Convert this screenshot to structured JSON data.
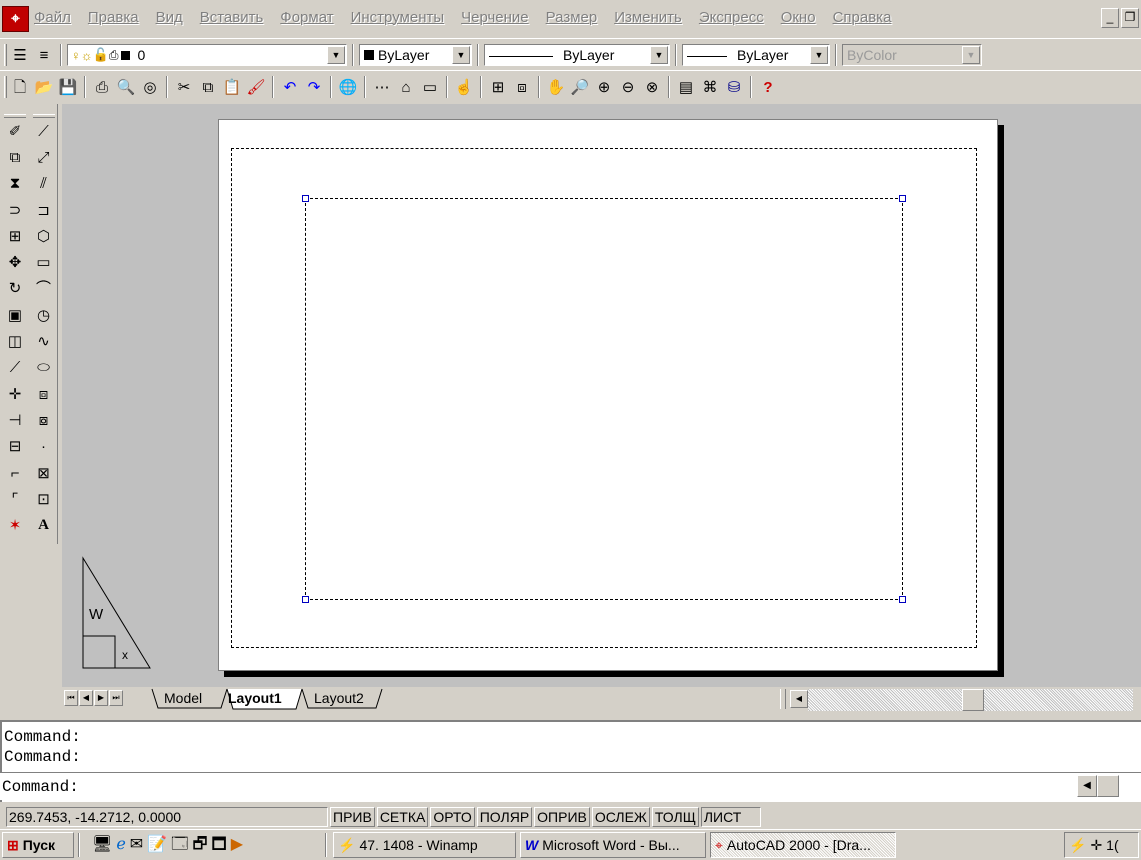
{
  "menu": {
    "items": [
      "Файл",
      "Правка",
      "Вид",
      "Вставить",
      "Формат",
      "Инструменты",
      "Черчение",
      "Размер",
      "Изменить",
      "Экспресс",
      "Окно",
      "Справка"
    ],
    "app_icon_glyph": "⌖"
  },
  "properties_toolbar": {
    "layer_value": "0",
    "color_value": "ByLayer",
    "linetype_value": "ByLayer",
    "lineweight_value": "ByLayer",
    "plotstyle_value": "ByColor"
  },
  "tabs": {
    "model": "Model",
    "layout1": "Layout1",
    "layout2": "Layout2",
    "active": "Layout1"
  },
  "command_window": {
    "history": [
      "Command:",
      "Command:"
    ],
    "prompt": "Command:"
  },
  "status_bar": {
    "coordinates": "269.7453, -14.2712, 0.0000",
    "toggles": [
      "ПРИВ",
      "СЕТКА",
      "ОРТО",
      "ПОЛЯР",
      "ОПРИВ",
      "ОСЛЕЖ",
      "ТОЛЩ",
      "ЛИСТ"
    ]
  },
  "taskbar": {
    "start_label": "Пуск",
    "buttons": [
      "47. 1408 - Winamp",
      "Microsoft Word - Вы...",
      "AutoCAD 2000 - [Dra..."
    ],
    "tray_text": "1("
  },
  "ucs": {
    "w_label": "W",
    "x_label": "x"
  },
  "colors": {
    "face": "#d4d0c8",
    "canvas_bg": "#c0c0c0",
    "grip": "#0000c0",
    "autocad_red": "#c00000"
  }
}
